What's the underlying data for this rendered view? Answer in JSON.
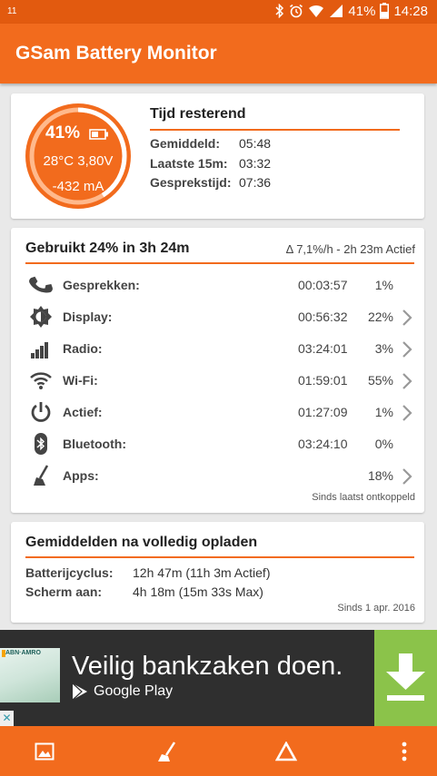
{
  "status_bar": {
    "notification_count": "11",
    "battery": "41%",
    "time": "14:28"
  },
  "app_bar": {
    "title": "GSam Battery Monitor"
  },
  "gauge": {
    "percent": "41%",
    "level": 0.41,
    "temp_voltage": "28°C  3,80V",
    "current": "-432 mA"
  },
  "remaining": {
    "title": "Tijd resterend",
    "rows": [
      {
        "label": "Gemiddeld:",
        "value": "05:48"
      },
      {
        "label": "Laatste 15m:",
        "value": "03:32"
      },
      {
        "label": "Gesprekstijd:",
        "value": "07:36"
      }
    ]
  },
  "usage": {
    "title": "Gebruikt 24% in 3h 24m",
    "active_summary": "Δ 7,1%/h - 2h 23m Actief",
    "rows": [
      {
        "label": "Gesprekken:",
        "time": "00:03:57",
        "pct": "1%",
        "icon": "phone-icon"
      },
      {
        "label": "Display:",
        "time": "00:56:32",
        "pct": "22%",
        "icon": "brightness-icon"
      },
      {
        "label": "Radio:",
        "time": "03:24:01",
        "pct": "3%",
        "icon": "signal-bars-icon"
      },
      {
        "label": "Wi-Fi:",
        "time": "01:59:01",
        "pct": "55%",
        "icon": "wifi-icon"
      },
      {
        "label": "Actief:",
        "time": "01:27:09",
        "pct": "1%",
        "icon": "power-icon"
      },
      {
        "label": "Bluetooth:",
        "time": "03:24:10",
        "pct": "0%",
        "icon": "bluetooth-icon"
      },
      {
        "label": "Apps:",
        "time": "",
        "pct": "18%",
        "icon": "broom-icon"
      }
    ],
    "footer": "Sinds laatst ontkoppeld"
  },
  "averages": {
    "title": "Gemiddelden na volledig opladen",
    "rows": [
      {
        "label": "Batterijcyclus:",
        "value": "12h 47m (11h 3m Actief)"
      },
      {
        "label": "Scherm aan:",
        "value": "4h 18m (15m 33s Max)"
      }
    ],
    "footer": "Sinds 1 apr. 2016"
  },
  "ad": {
    "brand": "ABN·AMRO",
    "headline": "Veilig bankzaken doen.",
    "store": "Google Play",
    "close": "✕"
  },
  "colors": {
    "primary": "#f26b1d",
    "status_bar": "#e25a0f",
    "ad_download": "#8bc34a"
  }
}
